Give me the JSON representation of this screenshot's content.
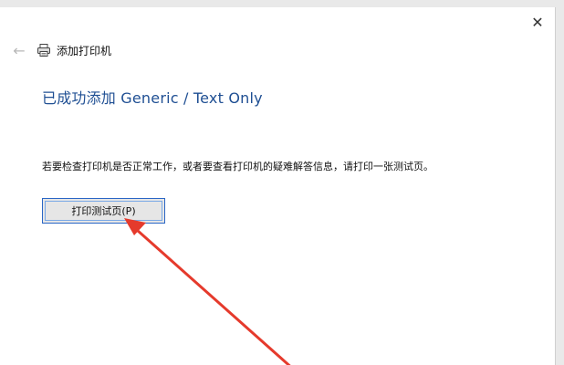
{
  "window": {
    "title": "添加打印机",
    "close_glyph": "✕",
    "back_glyph": "←",
    "icons": {
      "close": "close-icon",
      "back": "back-arrow-icon",
      "printer": "printer-icon"
    }
  },
  "main": {
    "heading": "已成功添加 Generic / Text Only",
    "instructions": "若要检查打印机是否正常工作，或者要查看打印机的疑难解答信息，请打印一张测试页。",
    "print_test_button": "打印测试页(P)"
  },
  "annotation": {
    "arrow_color": "#e53a2c"
  },
  "colors": {
    "heading": "#1f4f93",
    "button_border": "#2a66c5",
    "button_face": "#e6e6e6",
    "background": "#ffffff"
  }
}
